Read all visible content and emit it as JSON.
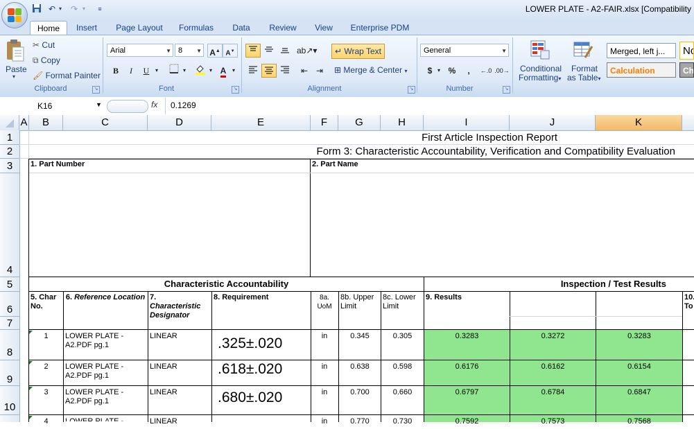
{
  "window": {
    "title": "LOWER PLATE - A2-FAIR.xlsx  [Compatibility"
  },
  "quick_access": {
    "save_icon": "save-icon",
    "undo_icon": "undo-icon",
    "redo_icon": "redo-icon"
  },
  "tabs": [
    {
      "label": "Home",
      "active": true
    },
    {
      "label": "Insert"
    },
    {
      "label": "Page Layout"
    },
    {
      "label": "Formulas"
    },
    {
      "label": "Data"
    },
    {
      "label": "Review"
    },
    {
      "label": "View"
    },
    {
      "label": "Enterprise PDM"
    }
  ],
  "ribbon": {
    "clipboard": {
      "label": "Clipboard",
      "paste": "Paste",
      "cut": "Cut",
      "copy": "Copy",
      "format_painter": "Format Painter"
    },
    "font": {
      "label": "Font",
      "font_name": "Arial",
      "font_size": "8"
    },
    "alignment": {
      "label": "Alignment",
      "wrap_text": "Wrap Text",
      "merge_center": "Merge & Center"
    },
    "number": {
      "label": "Number",
      "format": "General",
      "currency": "$",
      "percent": "%",
      "comma": ","
    },
    "styles": {
      "conditional_formatting_1": "Conditional",
      "conditional_formatting_2": "Formatting",
      "format_table_1": "Format",
      "format_table_2": "as Table",
      "style_merged": "Merged, left j...",
      "style_calculation": "Calculation",
      "style_normal": "No",
      "style_check": "Ch"
    }
  },
  "formula_bar": {
    "name_box": "K16",
    "fx": "fx",
    "value": "0.1269"
  },
  "columns": [
    "A",
    "B",
    "C",
    "D",
    "E",
    "F",
    "G",
    "H",
    "I",
    "J",
    "K"
  ],
  "selected_column": "K",
  "rows": [
    "1",
    "2",
    "3",
    "4",
    "5",
    "6",
    "7",
    "8",
    "9",
    "10"
  ],
  "sheet": {
    "title1": "First Article Inspection Report",
    "title2": "Form 3: Characteristic Accountability, Verification and Compatibility Evaluation",
    "part_number_label": "1. Part Number",
    "part_name_label": "2. Part Name",
    "char_accountability": "Characteristic Accountability",
    "inspection_results": "Inspection / Test Results",
    "headers": {
      "char_no": "5. Char No.",
      "ref_loc_num": "6.",
      "ref_loc": "Reference Location",
      "char_des_num": "7.",
      "char_des": "Characteristic Designator",
      "requirement": "8. Requirement",
      "uom_num": "8a.",
      "uom": "UoM",
      "upper": "8b. Upper Limit",
      "lower": "8c. Lower Limit",
      "results": "9. Results",
      "col10": "10. To"
    },
    "data_rows": [
      {
        "no": "1",
        "ref": "LOWER PLATE - A2.PDF pg.1",
        "des": "LINEAR",
        "req": ".325±.020",
        "uom": "in",
        "upper": "0.345",
        "lower": "0.305",
        "r1": "0.3283",
        "r2": "0.3272",
        "r3": "0.3283"
      },
      {
        "no": "2",
        "ref": "LOWER PLATE - A2.PDF pg.1",
        "des": "LINEAR",
        "req": ".618±.020",
        "uom": "in",
        "upper": "0.638",
        "lower": "0.598",
        "r1": "0.6176",
        "r2": "0.6162",
        "r3": "0.6154"
      },
      {
        "no": "3",
        "ref": "LOWER PLATE - A2.PDF pg.1",
        "des": "LINEAR",
        "req": ".680±.020",
        "uom": "in",
        "upper": "0.700",
        "lower": "0.660",
        "r1": "0.6797",
        "r2": "0.6784",
        "r3": "0.6847"
      },
      {
        "no": "4",
        "ref": "LOWER PLATE -",
        "des": "LINEAR",
        "req": "",
        "uom": "in",
        "upper": "0.770",
        "lower": "0.730",
        "r1": "0.7592",
        "r2": "0.7573",
        "r3": "0.7568"
      }
    ]
  }
}
